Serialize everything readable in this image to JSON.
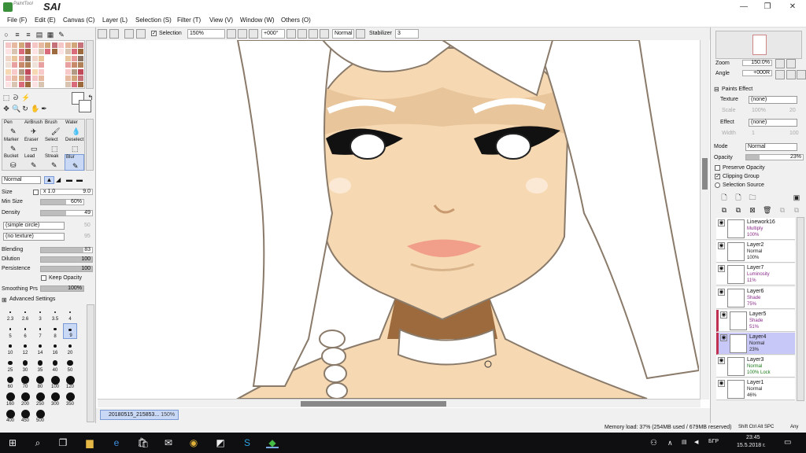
{
  "app": {
    "subtitle": "PaintTool",
    "name": "SAI"
  },
  "window": {
    "minimize": "—",
    "maximize": "❐",
    "close": "✕"
  },
  "menu": [
    "File (F)",
    "Edit (E)",
    "Canvas (C)",
    "Layer (L)",
    "Selection (S)",
    "Filter (T)",
    "View (V)",
    "Window (W)",
    "Others (O)"
  ],
  "toolbar": {
    "selection_label": "Selection",
    "zoom": "150%",
    "angle": "+000°",
    "mode": "Normal",
    "stabilizer_label": "Stabilizer",
    "stabilizer": "3"
  },
  "tools": {
    "brushes": [
      {
        "label": "Pen",
        "icon": "✎"
      },
      {
        "label": "AirBrush",
        "icon": "✈"
      },
      {
        "label": "Brush",
        "icon": "🖌"
      },
      {
        "label": "Water",
        "icon": "💧"
      },
      {
        "label": "Marker",
        "icon": "✎"
      },
      {
        "label": "Eraser",
        "icon": "▭"
      },
      {
        "label": "Select",
        "icon": "⬚"
      },
      {
        "label": "Deselect",
        "icon": "⬚"
      },
      {
        "label": "Bucket",
        "icon": "⛁"
      },
      {
        "label": "Lead",
        "icon": "✎"
      },
      {
        "label": "Streak",
        "icon": "✎"
      },
      {
        "label": "Blur",
        "icon": "✎"
      }
    ],
    "blend_mode": "Normal"
  },
  "brush_settings": {
    "size_label": "Size",
    "size_mult": "x 1.0",
    "size": "9.0",
    "min_size_label": "Min Size",
    "min_size": "60%",
    "min_size_fraction": 0.6,
    "density_label": "Density",
    "density": "49",
    "density_fraction": 0.49,
    "shape": "(simple circle)",
    "shape_val": "50",
    "texture": "(no texture)",
    "texture_val": "95",
    "blending_label": "Blending",
    "blending": "83",
    "blending_fraction": 0.83,
    "dilution_label": "Dilution",
    "dilution": "100",
    "dilution_fraction": 1.0,
    "persistence_label": "Persistence",
    "persistence": "100",
    "persistence_fraction": 1.0,
    "keep_opacity": "Keep Opacity",
    "smoothing_label": "Smoothing Prs",
    "smoothing": "100%",
    "smoothing_fraction": 1.0,
    "advanced": "Advanced Settings"
  },
  "brush_sizes": [
    "2.3",
    "2.6",
    "3",
    "3.5",
    "4",
    "5",
    "6",
    "7",
    "8",
    "9",
    "10",
    "12",
    "14",
    "16",
    "20",
    "25",
    "30",
    "35",
    "40",
    "50",
    "60",
    "70",
    "80",
    "100",
    "120",
    "160",
    "200",
    "250",
    "300",
    "350",
    "400",
    "450",
    "500"
  ],
  "navigator": {
    "zoom_label": "Zoom",
    "zoom": "150.0%",
    "angle_label": "Angle",
    "angle": "+000R"
  },
  "paints_effect": {
    "title": "Paints Effect",
    "texture_label": "Texture",
    "texture": "(none)",
    "scale_label": "Scale",
    "scale": "100%",
    "scale_val": "20",
    "effect_label": "Effect",
    "effect": "(none)",
    "width_label": "Width",
    "width": "1",
    "width_val": "100"
  },
  "layer_props": {
    "mode_label": "Mode",
    "mode": "Normal",
    "opacity_label": "Opacity",
    "opacity": "23%",
    "opacity_fraction": 0.23,
    "preserve_opacity": "Preserve Opacity",
    "clipping_group": "Clipping Group",
    "selection_source": "Selection Source"
  },
  "layers": [
    {
      "name": "Linework16",
      "mode": "Multiply",
      "opacity": "100%",
      "mode_color": "#8a2a8a"
    },
    {
      "name": "Layer2",
      "mode": "Normal",
      "opacity": "100%",
      "mode_color": "#222222"
    },
    {
      "name": "Layer7",
      "mode": "Luminosity",
      "opacity": "11%",
      "mode_color": "#8a2a8a"
    },
    {
      "name": "Layer6",
      "mode": "Shade",
      "opacity": "75%",
      "mode_color": "#8a2a8a"
    },
    {
      "name": "Layer5",
      "mode": "Shade",
      "opacity": "51%",
      "mode_color": "#8a2a8a"
    },
    {
      "name": "Layer4",
      "mode": "Normal",
      "opacity": "23%",
      "mode_color": "#222222"
    },
    {
      "name": "Layer3",
      "mode": "Normal",
      "opacity": "100% Lock",
      "mode_color": "#1a7a1a"
    },
    {
      "name": "Layer1",
      "mode": "Normal",
      "opacity": "46%",
      "mode_color": "#222222"
    }
  ],
  "document_tab": {
    "name": "20180515_215853...",
    "zoom": "150%"
  },
  "status": {
    "memory": "Memory load: 37% (254MB used / 679MB reserved)",
    "keys": "Shift Ctrl Alt SPC",
    "any": "Any"
  },
  "taskbar": {
    "time": "23:45",
    "date": "15.5.2018 г.",
    "lang": "БГР"
  },
  "colors": {
    "accent": "#c9d9f5",
    "skin": "#f6d9b2",
    "shadow": "#9c6a3c",
    "selected_layer": "#c8c8f8"
  }
}
